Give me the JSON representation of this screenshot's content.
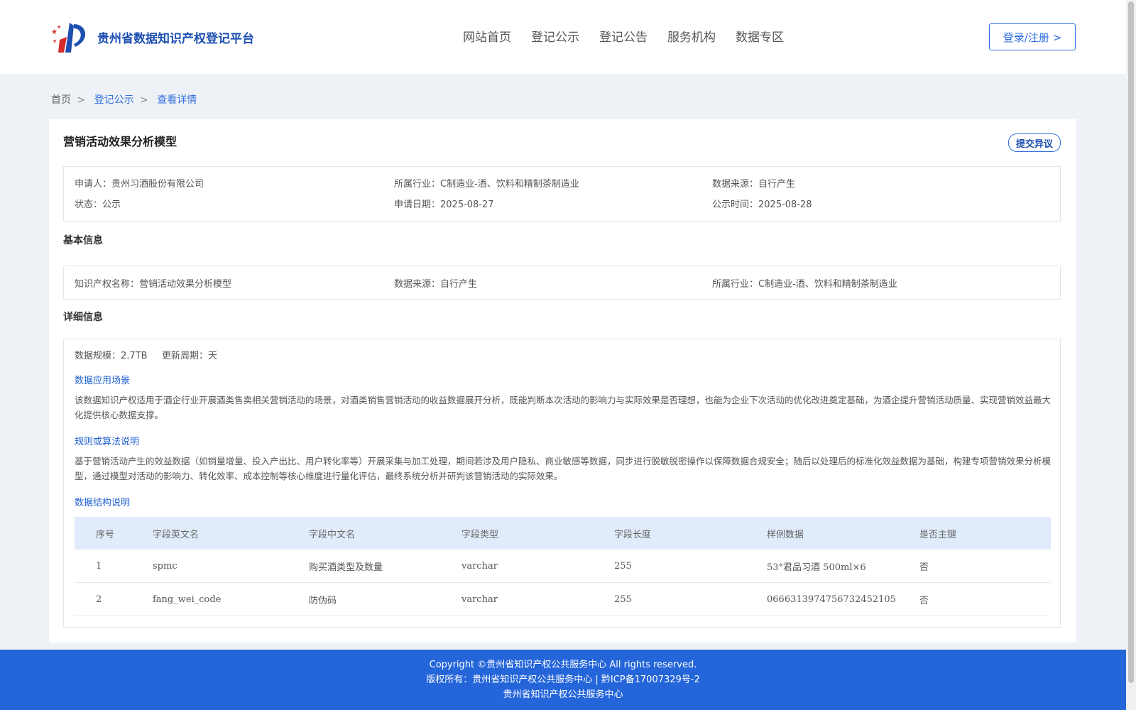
{
  "header": {
    "brand": "贵州省数据知识产权登记平台",
    "nav": [
      "网站首页",
      "登记公示",
      "登记公告",
      "服务机构",
      "数据专区"
    ],
    "login": "登录/注册 >"
  },
  "breadcrumb": {
    "home": "首页",
    "sep1": ">",
    "list": "登记公示",
    "sep2": ">",
    "current": "查看详情"
  },
  "detail": {
    "title": "营销活动效果分析模型",
    "objection": "提交异议",
    "summary": {
      "applicant_label": "申请人：",
      "applicant": "贵州习酒股份有限公司",
      "industry_label": "所属行业：",
      "industry": "C制造业-酒、饮料和精制茶制造业",
      "source_label": "数据来源：",
      "source": "自行产生",
      "status_label": "状态：",
      "status": "公示",
      "apply_date_label": "申请日期：",
      "apply_date": "2025-08-27",
      "publish_date_label": "公示时间：",
      "publish_date": "2025-08-28"
    },
    "basic_title": "基本信息",
    "basic": {
      "name_label": "知识产权名称：",
      "name": "营销活动效果分析模型",
      "source_label": "数据来源：",
      "source": "自行产生",
      "industry_label": "所属行业：",
      "industry": "C制造业-酒、饮料和精制茶制造业"
    },
    "detail_title": "详细信息",
    "scale_label": "数据规模：",
    "scale": "2.7TB",
    "cycle_label": "更新周期：",
    "cycle": "天",
    "scene_title": "数据应用场景",
    "scene_text": "该数据知识产权适用于酒企行业开展酒类售卖相关营销活动的场景，对酒类销售营销活动的收益数据展开分析，既能判断本次活动的影响力与实际效果是否理想，也能为企业下次活动的优化改进奠定基础，为酒企提升营销活动质量、实现营销效益最大化提供核心数据支撑。",
    "rule_title": "规则或算法说明",
    "rule_text": "基于营销活动产生的效益数据（如销量增量、投入产出比、用户转化率等）开展采集与加工处理，期间若涉及用户隐私、商业敏感等数据，同步进行脱敏脱密操作以保障数据合规安全；随后以处理后的标准化效益数据为基础，构建专项营销效果分析模型，通过模型对活动的影响力、转化效率、成本控制等核心维度进行量化评估，最终系统分析并研判该营销活动的实际效果。",
    "struct_title": "数据结构说明",
    "table": {
      "headers": [
        "序号",
        "字段英文名",
        "字段中文名",
        "字段类型",
        "字段长度",
        "样例数据",
        "是否主键"
      ],
      "rows": [
        [
          "1",
          "spmc",
          "购买酒类型及数量",
          "varchar",
          "255",
          "53°君品习酒 500ml×6",
          "否"
        ],
        [
          "2",
          "fang_wei_code",
          "防伪码",
          "varchar",
          "255",
          "0666313974756732452105",
          "否"
        ]
      ]
    }
  },
  "footer": {
    "line1": "Copyright ©贵州省知识产权公共服务中心 All rights reserved.",
    "line2": "版权所有：贵州省知识产权公共服务中心 | 黔ICP备17007329号-2",
    "line3": "贵州省知识产权公共服务中心"
  },
  "colors": {
    "primary": "#2465d9",
    "link": "#2f6fe0",
    "page_bg": "#eef1f5",
    "table_head": "#e0ecfb"
  }
}
